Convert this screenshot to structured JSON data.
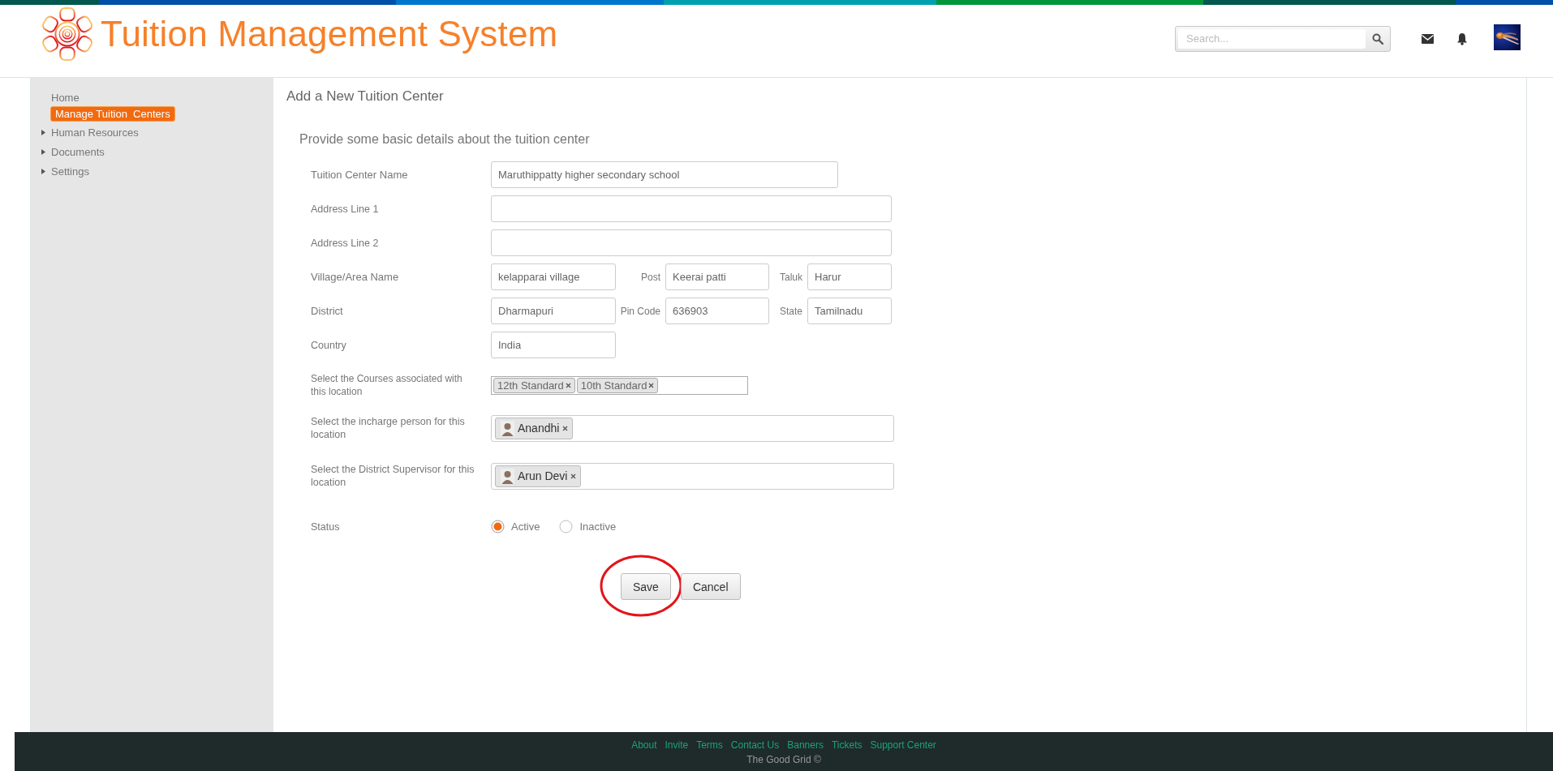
{
  "header": {
    "title": "Tuition Management System",
    "search": {
      "placeholder": "Search..."
    }
  },
  "sidebar": {
    "items": [
      {
        "label": "Home",
        "selected": false,
        "expandable": false
      },
      {
        "label": "Manage Tuition  Centers",
        "selected": true,
        "expandable": false
      },
      {
        "label": "Human Resources",
        "selected": false,
        "expandable": true
      },
      {
        "label": "Documents",
        "selected": false,
        "expandable": true
      },
      {
        "label": "Settings",
        "selected": false,
        "expandable": true
      }
    ]
  },
  "page": {
    "title": "Add a New Tuition Center",
    "subtitle": "Provide some basic details about the tuition center"
  },
  "form": {
    "rows": [
      {
        "kind": "medium",
        "label": "Tuition Center Name",
        "value": "Maruthippatty higher secondary school"
      },
      {
        "kind": "wide",
        "label": "Address Line 1"
      },
      {
        "kind": "wide",
        "label": "Address Line 2"
      },
      {
        "kind": "multi",
        "label": "Village/Area Name",
        "value": "kelapparai village",
        "fields": [
          {
            "label": "Post",
            "value": "Keerai patti"
          },
          {
            "label": "Taluk",
            "value": "Harur"
          }
        ]
      },
      {
        "kind": "multi",
        "label": "District",
        "value": "Dharmapuri",
        "fields": [
          {
            "label": "Pin Code",
            "value": "636903"
          },
          {
            "label": "State",
            "value": "Tamilnadu"
          }
        ]
      },
      {
        "kind": "short",
        "label": "Country",
        "value": "India"
      },
      {
        "kind": "tags",
        "label": "Select the Courses associated with this location",
        "tags": [
          "12th Standard",
          "10th Standard"
        ]
      },
      {
        "kind": "people",
        "label": "Select the incharge person for this location",
        "people": [
          "Anandhi"
        ]
      },
      {
        "kind": "people",
        "label": "Select the District Supervisor for this location",
        "people": [
          "Arun Devi"
        ]
      },
      {
        "kind": "radio",
        "label": "Status",
        "options": [
          {
            "label": "Active",
            "selected": true
          },
          {
            "label": "Inactive",
            "selected": false
          }
        ]
      }
    ],
    "buttons": [
      {
        "label": "Save",
        "annotated": true
      },
      {
        "label": "Cancel",
        "annotated": false
      }
    ]
  },
  "footer": {
    "links": [
      "About",
      "Invite",
      "Terms",
      "Contact Us",
      "Banners",
      "Tickets",
      "Support Center"
    ],
    "copyright": "The Good Grid ©"
  }
}
